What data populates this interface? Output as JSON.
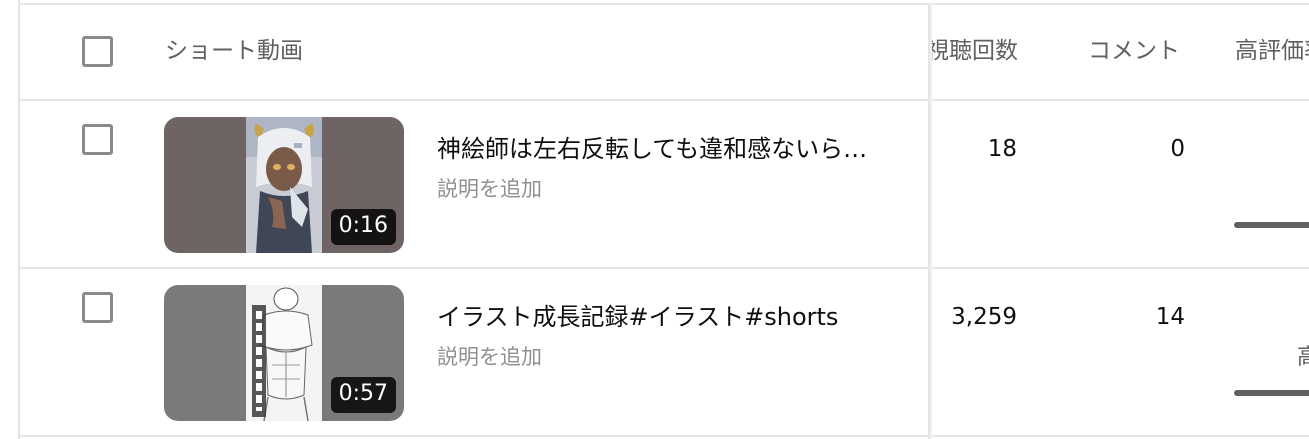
{
  "header": {
    "short_video": "ショート動画",
    "views": "視聴回数",
    "comments": "コメント",
    "likes": "高評価率"
  },
  "rows": [
    {
      "title": "神絵師は左右反転しても違和感ないら…",
      "description": "説明を追加",
      "duration": "0:16",
      "views": "18",
      "comments": "0",
      "likes_partial": ""
    },
    {
      "title": "イラスト成長記録#イラスト#shorts",
      "description": "説明を追加",
      "duration": "0:57",
      "views": "3,259",
      "comments": "14",
      "likes_partial": "高"
    }
  ],
  "colors": {
    "thumb1_bg": "#6f6464",
    "thumb2_bg": "#7a7a7a",
    "text_secondary": "#606060"
  }
}
